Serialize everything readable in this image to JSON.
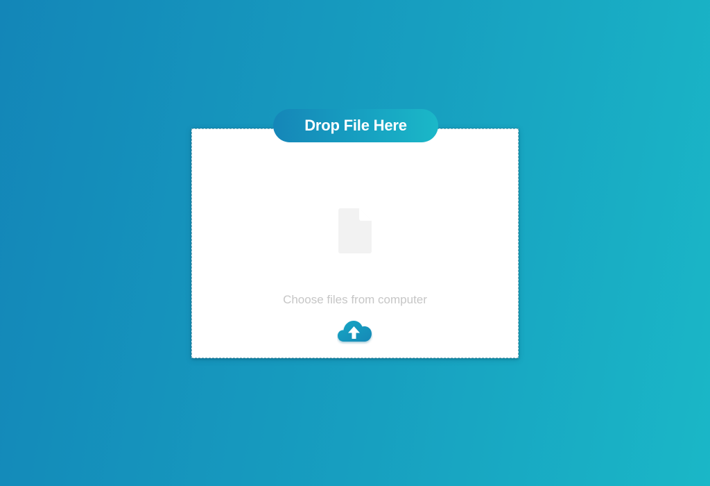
{
  "header": {
    "title": "Drop File Here"
  },
  "dropzone": {
    "file_icon": "file-icon",
    "hint": "Choose files from computer",
    "upload_icon": "cloud-upload-icon"
  },
  "colors": {
    "gradient_start": "#1386b8",
    "gradient_end": "#1ab7c7",
    "card_background": "#ffffff",
    "hint_text": "#c6c6c6",
    "file_icon": "#f2f2f2"
  }
}
